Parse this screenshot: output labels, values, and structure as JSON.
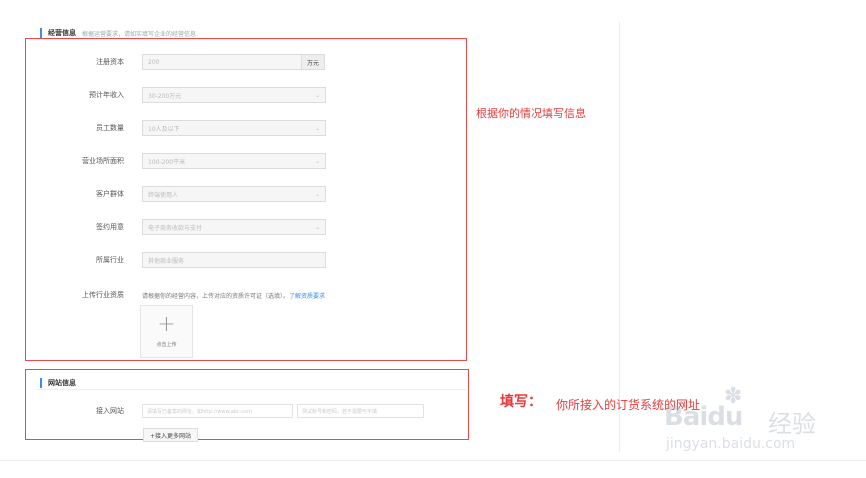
{
  "operations": {
    "section_title": "经营信息",
    "section_sub": "根据运营要求，请如实填写企业的经营信息",
    "fields": [
      {
        "label": "注册资本",
        "value": "200",
        "unit": "万元"
      },
      {
        "label": "预计年收入",
        "value": "30-200万元"
      },
      {
        "label": "员工数量",
        "value": "10人及以下"
      },
      {
        "label": "营业场所面积",
        "value": "100-200平米"
      },
      {
        "label": "客户群体",
        "value": "终端使用人"
      },
      {
        "label": "签约用意",
        "value": "电子商务收款与支付"
      },
      {
        "label": "所属行业",
        "value": "其他商业服务"
      }
    ],
    "upload_label": "上传行业资质",
    "upload_note": "请根据你的经营内容，上传对应的资质许可证（选填）。",
    "upload_link": "了解资质要求",
    "upload_caption": "点击上传",
    "plus_icon": "plus-icon"
  },
  "website": {
    "section_title": "网站信息",
    "label": "接入网站",
    "url_placeholder": "请填写已备案的网址，如http://www.abc.com",
    "account_placeholder": "测试账号和密码，若不需要可不填",
    "add_button": "+接入更多网站"
  },
  "annotations": {
    "note1": "根据你的情况填写信息",
    "note2_prefix": "填写：",
    "note2_text": "你所接入的订货系统的网址"
  },
  "watermark": {
    "brand": "Baidu",
    "brand_cn": "经验",
    "url": "jingyan.baidu.com"
  },
  "colors": {
    "annotation_red": "#e53b3b",
    "accent_blue": "#3a8ee6"
  }
}
